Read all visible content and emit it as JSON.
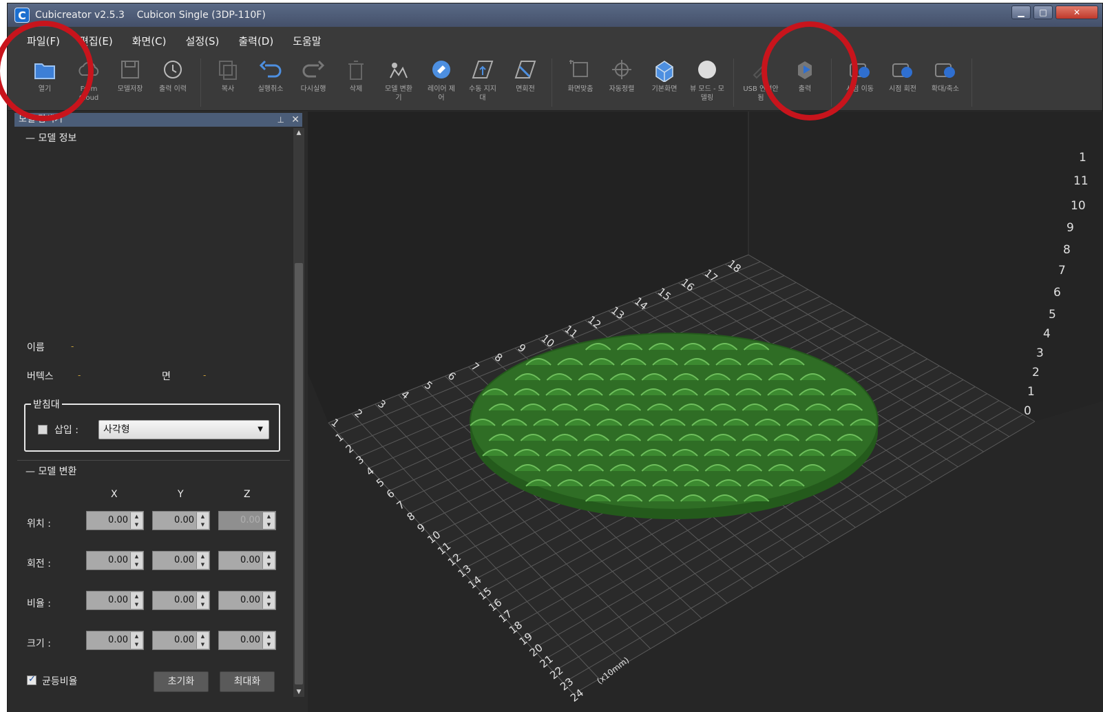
{
  "window": {
    "app_icon": "C",
    "title": "Cubicreator v2.5.3    Cubicon Single (3DP-110F)",
    "minimize": "▁",
    "maximize": "□",
    "close": "✕",
    "colors": {
      "title_bg": "#4f5d78",
      "panel_bg": "#2b2b2b",
      "viewport_bg": "#262626",
      "model": "#2e6b24",
      "annotation": "#c8141c"
    }
  },
  "menu": [
    "파일(F)",
    "편집(E)",
    "화면(C)",
    "설정(S)",
    "출력(D)",
    "도움말"
  ],
  "toolbar": [
    {
      "label": "열기",
      "icon": "folder-open-icon"
    },
    {
      "label": "From\nCloud",
      "icon": "cloud-icon"
    },
    {
      "label": "모델저장",
      "icon": "save-icon"
    },
    {
      "label": "출력 이력",
      "icon": "history-icon"
    },
    {
      "label": "복사",
      "icon": "copy-icon"
    },
    {
      "label": "실행취소",
      "icon": "undo-icon"
    },
    {
      "label": "다시실행",
      "icon": "redo-icon"
    },
    {
      "label": "삭제",
      "icon": "trash-icon"
    },
    {
      "label": "모델 변환\n기",
      "icon": "model-convert-icon"
    },
    {
      "label": "레이어 제\n어",
      "icon": "layer-control-icon"
    },
    {
      "label": "수동 지지\n대",
      "icon": "manual-support-icon"
    },
    {
      "label": "면회전",
      "icon": "face-rotate-icon"
    },
    {
      "label": "화면맞춤",
      "icon": "fit-screen-icon"
    },
    {
      "label": "자동정렬",
      "icon": "auto-arrange-icon"
    },
    {
      "label": "기본화면",
      "icon": "default-view-icon"
    },
    {
      "label": "뷰 모드 - 모\n델링",
      "icon": "view-mode-icon"
    },
    {
      "label": "USB 연결안\n됨",
      "icon": "usb-icon"
    },
    {
      "label": "출력",
      "icon": "print-icon"
    },
    {
      "label": "시점 이동",
      "icon": "view-move-icon"
    },
    {
      "label": "시점 회전",
      "icon": "view-rotate-icon"
    },
    {
      "label": "확대/축소",
      "icon": "zoom-icon"
    }
  ],
  "panel": {
    "header": "모델 탐색기",
    "pin": "📌",
    "close": "✕",
    "model_info_title": "모델 정보",
    "name_label": "이름",
    "name_value": "-",
    "vertex_label": "버텍스",
    "vertex_value": "-",
    "face_label": "면",
    "face_value": "-",
    "support": {
      "legend": "받침대",
      "insert_label": "삽입 :",
      "insert_checked": false,
      "shape_value": "사각형"
    },
    "transform_title": "모델 변환",
    "axes": [
      "X",
      "Y",
      "Z"
    ],
    "rows": [
      {
        "label": "위치 :",
        "values": [
          "0.00",
          "0.00",
          "0.00"
        ],
        "z_disabled": true
      },
      {
        "label": "회전 :",
        "values": [
          "0.00",
          "0.00",
          "0.00"
        ],
        "z_disabled": false
      },
      {
        "label": "비율 :",
        "values": [
          "0.00",
          "0.00",
          "0.00"
        ],
        "z_disabled": false
      },
      {
        "label": "크기 :",
        "values": [
          "0.00",
          "0.00",
          "0.00"
        ],
        "z_disabled": false
      }
    ],
    "uniform_label": "균등비율",
    "uniform_checked": true,
    "reset_button": "초기화",
    "maximize_button": "최대화"
  },
  "viewport": {
    "x_axis_labels": [
      "1",
      "2",
      "3",
      "4",
      "5",
      "6",
      "7",
      "8",
      "9",
      "10",
      "11",
      "12",
      "13",
      "14",
      "15",
      "16",
      "17",
      "18",
      "19",
      "20",
      "21",
      "22",
      "23",
      "24"
    ],
    "x_unit": "(x10mm)",
    "y_axis_labels": [
      "1",
      "2",
      "3",
      "4",
      "5",
      "6",
      "7",
      "8",
      "9",
      "10",
      "11",
      "12",
      "13",
      "14",
      "15",
      "16",
      "17",
      "18"
    ],
    "z_axis_labels": [
      "0",
      "1",
      "2",
      "3",
      "4",
      "5",
      "6",
      "7",
      "8",
      "9",
      "10",
      "11",
      "1"
    ]
  }
}
